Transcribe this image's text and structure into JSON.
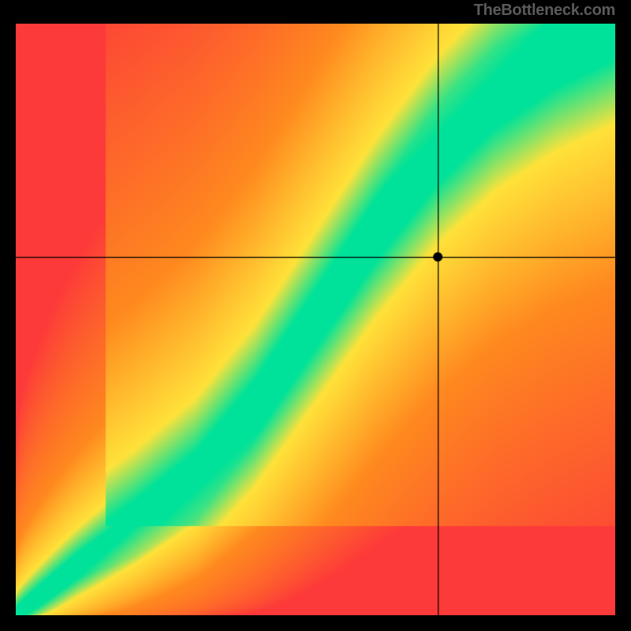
{
  "watermark": "TheBottleneck.com",
  "chart_data": {
    "type": "heatmap",
    "title": "",
    "xlabel": "",
    "ylabel": "",
    "xlim": [
      0,
      100
    ],
    "ylim": [
      0,
      100
    ],
    "crosshair": {
      "x": 70.5,
      "y": 60.5
    },
    "marker": {
      "x": 70.5,
      "y": 60.5
    },
    "ridge_path": [
      {
        "x": 0,
        "y": 0
      },
      {
        "x": 10,
        "y": 8
      },
      {
        "x": 20,
        "y": 15
      },
      {
        "x": 30,
        "y": 23
      },
      {
        "x": 40,
        "y": 35
      },
      {
        "x": 50,
        "y": 50
      },
      {
        "x": 60,
        "y": 65
      },
      {
        "x": 70,
        "y": 78
      },
      {
        "x": 80,
        "y": 88
      },
      {
        "x": 90,
        "y": 95
      },
      {
        "x": 100,
        "y": 100
      }
    ],
    "colors": {
      "ridge": "#00e29a",
      "yellow": "#ffe23a",
      "orange": "#ff8a1f",
      "red": "#fd3a3a"
    },
    "gradient_description": "Green ridge curve from lower-left to upper-right; yellow near ridge; orange mid-distance; red far from ridge. Crosshair and solid black dot at marker position."
  }
}
